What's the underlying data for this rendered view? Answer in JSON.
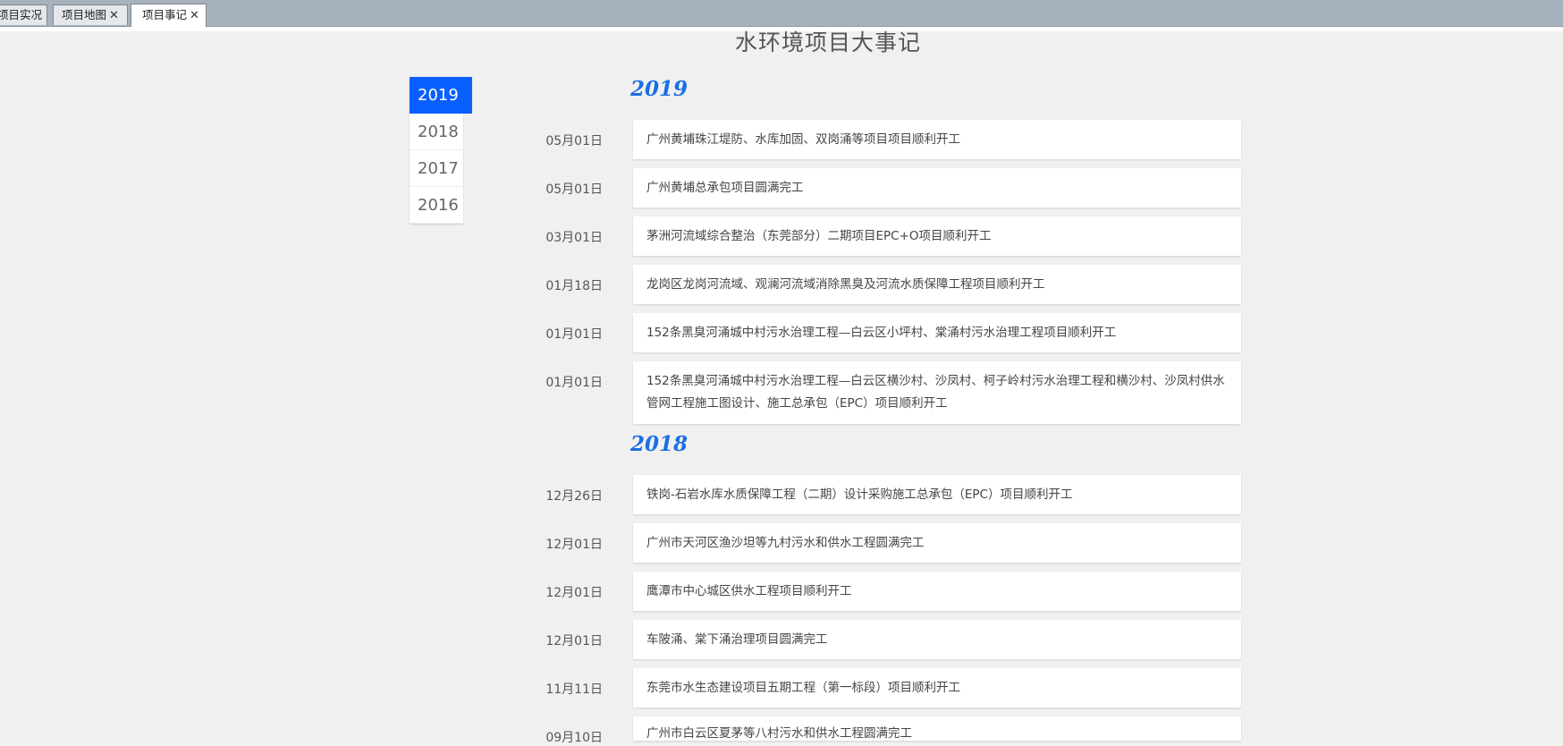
{
  "tabs": [
    {
      "label": "项目实况",
      "closable": false
    },
    {
      "label": "项目地图",
      "closable": true
    },
    {
      "label": "项目事记",
      "closable": true,
      "active": true
    }
  ],
  "close_glyph": "✕",
  "page_title": "水环境项目大事记",
  "year_nav": [
    "2019",
    "2018",
    "2017",
    "2016"
  ],
  "years": [
    {
      "year": "2019",
      "events": [
        {
          "date": "05月01日",
          "text": "广州黄埔珠江堤防、水库加固、双岗涌等项目项目顺利开工"
        },
        {
          "date": "05月01日",
          "text": "广州黄埔总承包项目圆满完工"
        },
        {
          "date": "03月01日",
          "text": "茅洲河流域综合整治（东莞部分）二期项目EPC+O项目顺利开工"
        },
        {
          "date": "01月18日",
          "text": "龙岗区龙岗河流域、观澜河流域消除黑臭及河流水质保障工程项目顺利开工"
        },
        {
          "date": "01月01日",
          "text": "152条黑臭河涌城中村污水治理工程—白云区小坪村、棠涌村污水治理工程项目顺利开工"
        },
        {
          "date": "01月01日",
          "text": "152条黑臭河涌城中村污水治理工程—白云区横沙村、沙凤村、柯子岭村污水治理工程和横沙村、沙凤村供水管网工程施工图设计、施工总承包（EPC）项目顺利开工"
        }
      ]
    },
    {
      "year": "2018",
      "events": [
        {
          "date": "12月26日",
          "text": "铁岗-石岩水库水质保障工程（二期）设计采购施工总承包（EPC）项目顺利开工"
        },
        {
          "date": "12月01日",
          "text": "广州市天河区渔沙坦等九村污水和供水工程圆满完工"
        },
        {
          "date": "12月01日",
          "text": "鹰潭市中心城区供水工程项目顺利开工"
        },
        {
          "date": "12月01日",
          "text": "车陂涌、棠下涌治理项目圆满完工"
        },
        {
          "date": "11月11日",
          "text": "东莞市水生态建设项目五期工程（第一标段）项目顺利开工"
        },
        {
          "date": "09月10日",
          "text": "广州市白云区夏茅等八村污水和供水工程圆满完工"
        }
      ]
    }
  ]
}
